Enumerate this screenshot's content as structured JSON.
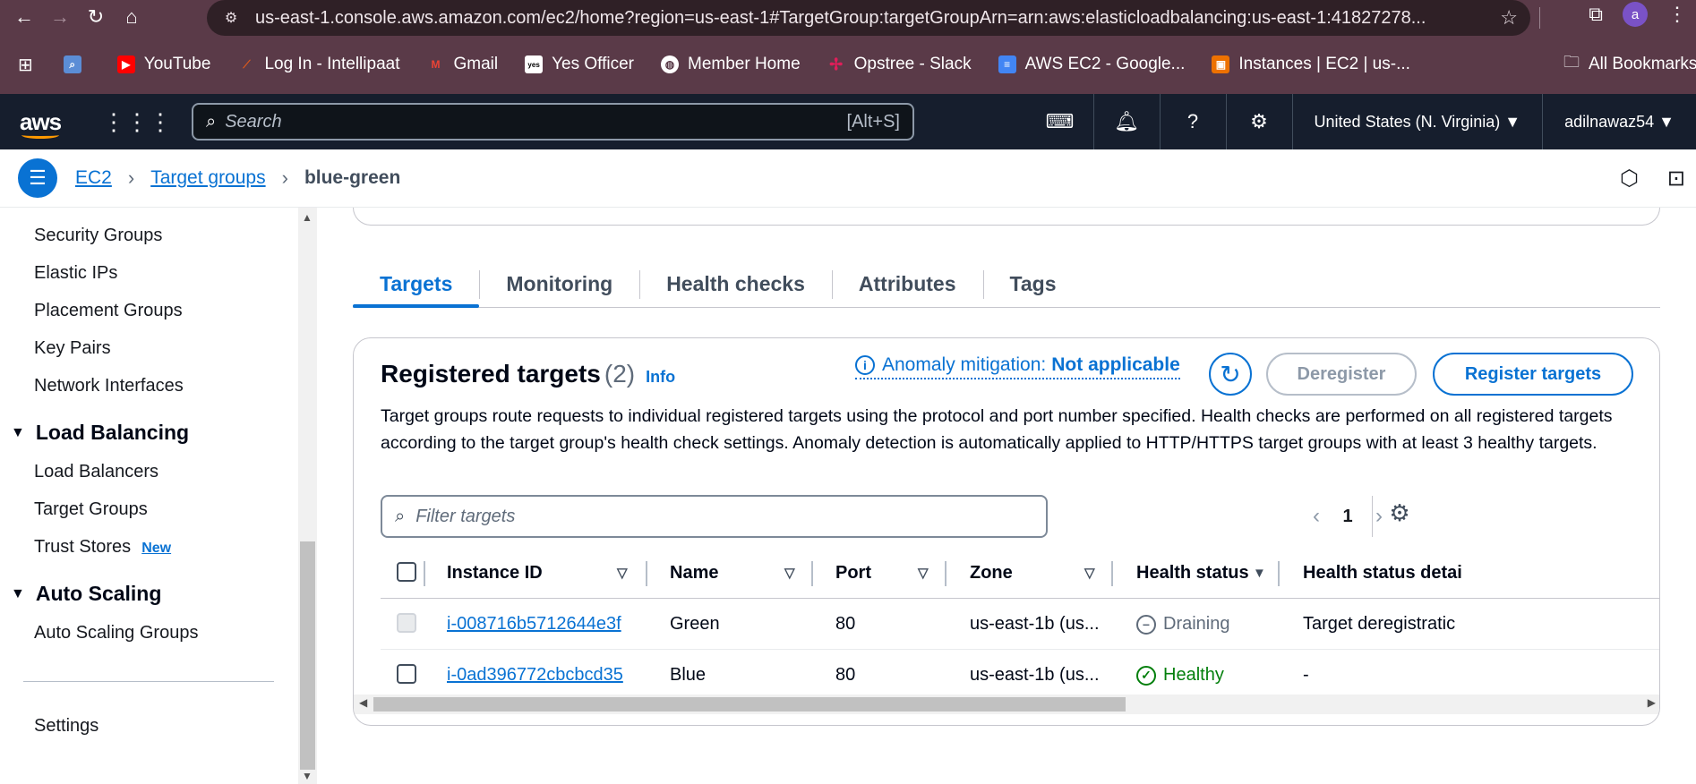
{
  "browser": {
    "url": "us-east-1.console.aws.amazon.com/ec2/home?region=us-east-1#TargetGroup:targetGroupArn=arn:aws:elasticloadbalancing:us-east-1:41827278...",
    "profile_initial": "a",
    "bookmarks": [
      {
        "label": "YouTube",
        "icon": "youtube-icon",
        "color": "#ff0000"
      },
      {
        "label": "Log In - Intellipaat",
        "icon": "intellipaat-icon",
        "color": "#e05a1a"
      },
      {
        "label": "Gmail",
        "icon": "gmail-icon",
        "color": "#ea4335"
      },
      {
        "label": "Yes Officer",
        "icon": "yes-officer-icon",
        "color": "#ffffff"
      },
      {
        "label": "Member Home",
        "icon": "globe-icon",
        "color": "#ffffff"
      },
      {
        "label": "Opstree - Slack",
        "icon": "slack-icon",
        "color": "#e01e5a"
      },
      {
        "label": "AWS EC2 - Google...",
        "icon": "google-docs-icon",
        "color": "#4285f4"
      },
      {
        "label": "Instances | EC2 | us-...",
        "icon": "ec2-icon",
        "color": "#ed7100"
      }
    ],
    "all_bookmarks": "All Bookmarks"
  },
  "aws_nav": {
    "logo": "aws",
    "search_placeholder": "Search",
    "search_shortcut": "[Alt+S]",
    "region": "United States (N. Virginia) ▼",
    "user": "adilnawaz54 ▼"
  },
  "breadcrumb": {
    "items": [
      "EC2",
      "Target groups"
    ],
    "current": "blue-green"
  },
  "sidebar": {
    "items_top": [
      "Security Groups",
      "Elastic IPs",
      "Placement Groups",
      "Key Pairs",
      "Network Interfaces"
    ],
    "load_balancing": {
      "heading": "Load Balancing",
      "items": [
        "Load Balancers",
        "Target Groups",
        "Trust Stores"
      ],
      "new_badge": "New"
    },
    "auto_scaling": {
      "heading": "Auto Scaling",
      "items": [
        "Auto Scaling Groups"
      ]
    },
    "settings": "Settings"
  },
  "tabs": [
    "Targets",
    "Monitoring",
    "Health checks",
    "Attributes",
    "Tags"
  ],
  "active_tab": "Targets",
  "registered_targets": {
    "title": "Registered targets",
    "count": "(2)",
    "info": "Info",
    "anomaly_label": "Anomaly mitigation:",
    "anomaly_value": "Not applicable",
    "deregister": "Deregister",
    "register": "Register targets",
    "description": "Target groups route requests to individual registered targets using the protocol and port number specified. Health checks are performed on all registered targets according to the target group's health check settings. Anomaly detection is automatically applied to HTTP/HTTPS target groups with at least 3 healthy targets.",
    "filter_placeholder": "Filter targets",
    "page": "1",
    "columns": [
      "Instance ID",
      "Name",
      "Port",
      "Zone",
      "Health status",
      "Health status detai"
    ],
    "rows": [
      {
        "instance_id": "i-008716b5712644e3f",
        "name": "Green",
        "port": "80",
        "zone": "us-east-1b (us...",
        "health": "Draining",
        "detail": "Target deregistratic",
        "checkbox_disabled": true
      },
      {
        "instance_id": "i-0ad396772cbcbcd35",
        "name": "Blue",
        "port": "80",
        "zone": "us-east-1b (us...",
        "health": "Healthy",
        "detail": "-",
        "checkbox_disabled": false
      }
    ]
  },
  "colors": {
    "link": "#0972d3",
    "healthy": "#037f0c",
    "aws_nav_bg": "#161e2d",
    "browser_bg": "#5a3a48"
  }
}
